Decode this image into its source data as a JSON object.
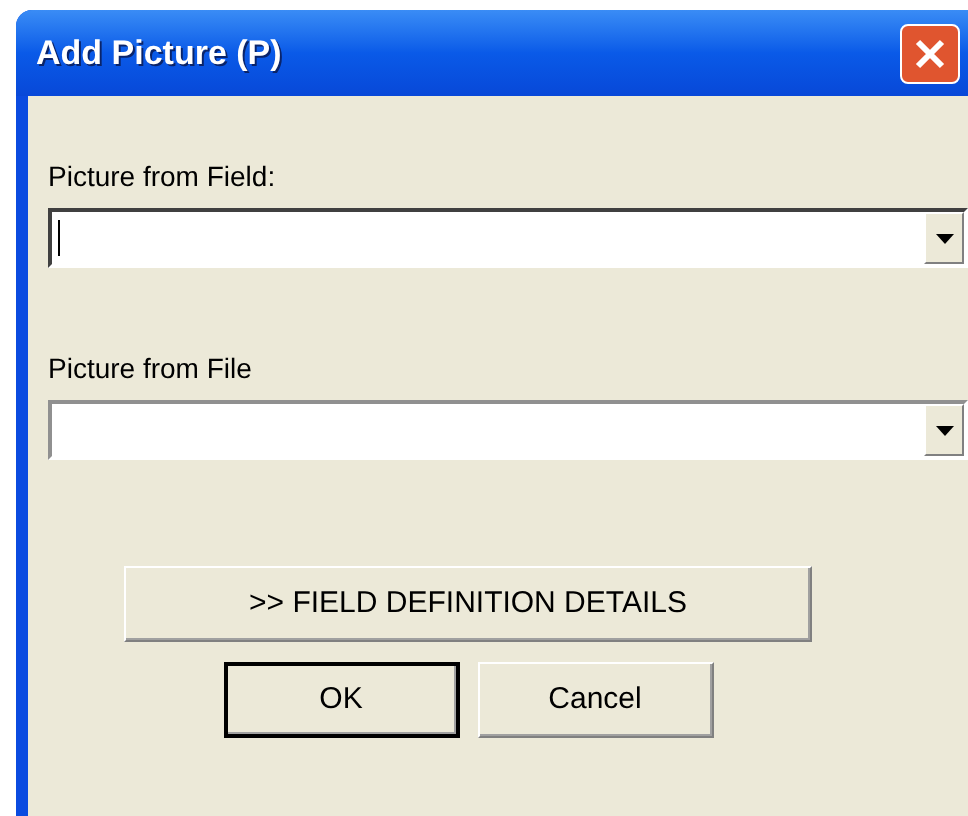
{
  "window": {
    "title": "Add Picture (P)"
  },
  "fields": [
    {
      "label": "Picture from Field:",
      "focused": true
    },
    {
      "label": "Picture from File",
      "focused": false
    }
  ],
  "buttons": [
    {
      "label": ">> FIELD DEFINITION DETAILS",
      "kind": "wide",
      "default": false
    },
    {
      "label": "OK",
      "kind": "normal",
      "default": true
    },
    {
      "label": "Cancel",
      "kind": "normal",
      "default": false
    }
  ]
}
